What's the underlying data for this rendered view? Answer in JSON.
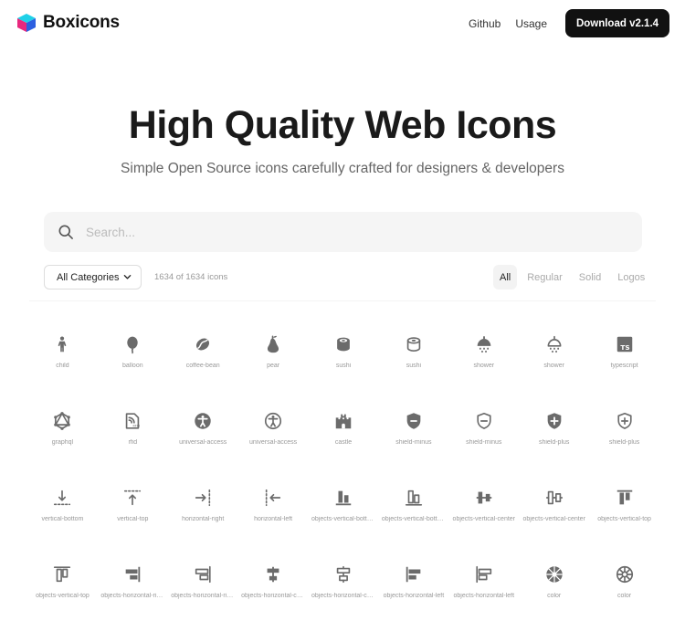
{
  "header": {
    "brand": "Boxicons",
    "nav": [
      "Github",
      "Usage"
    ],
    "download_label": "Download v2.1.4"
  },
  "hero": {
    "title": "High Quality Web Icons",
    "subtitle": "Simple Open Source icons carefully crafted for designers & developers"
  },
  "search": {
    "placeholder": "Search..."
  },
  "filters": {
    "category": "All Categories",
    "count": "1634 of 1634 icons",
    "tabs": [
      "All",
      "Regular",
      "Solid",
      "Logos"
    ],
    "active_tab": "All"
  },
  "colors": {
    "icon": "#6b6b6b",
    "button": "#111111",
    "brand_cyan": "#1fd1e8",
    "brand_pink": "#e8287e",
    "brand_blue": "#2d5fe0"
  },
  "icons": [
    {
      "icon": "child",
      "label": "child"
    },
    {
      "icon": "balloon",
      "label": "balloon"
    },
    {
      "icon": "coffee-bean",
      "label": "coffee-bean"
    },
    {
      "icon": "pear",
      "label": "pear"
    },
    {
      "icon": "sushi-solid",
      "label": "sushi"
    },
    {
      "icon": "sushi-regular",
      "label": "sushi"
    },
    {
      "icon": "shower-solid",
      "label": "shower"
    },
    {
      "icon": "shower-regular",
      "label": "shower"
    },
    {
      "icon": "typescript",
      "label": "typescript"
    },
    {
      "icon": "graphql",
      "label": "graphql"
    },
    {
      "icon": "rfid",
      "label": "rfid"
    },
    {
      "icon": "universal-access-solid",
      "label": "universal-access"
    },
    {
      "icon": "universal-access-regular",
      "label": "universal-access"
    },
    {
      "icon": "castle",
      "label": "castle"
    },
    {
      "icon": "shield-minus-solid",
      "label": "shield-minus"
    },
    {
      "icon": "shield-minus-regular",
      "label": "shield-minus"
    },
    {
      "icon": "shield-plus-solid",
      "label": "shield-plus"
    },
    {
      "icon": "shield-plus-regular",
      "label": "shield-plus"
    },
    {
      "icon": "vertical-bottom",
      "label": "vertical-bottom"
    },
    {
      "icon": "vertical-top",
      "label": "vertical-top"
    },
    {
      "icon": "horizontal-right",
      "label": "horizontal-right"
    },
    {
      "icon": "horizontal-left",
      "label": "horizontal-left"
    },
    {
      "icon": "objects-vertical-bottom-solid",
      "label": "objects-vertical-bottom"
    },
    {
      "icon": "objects-vertical-bottom-regular",
      "label": "objects-vertical-bottom"
    },
    {
      "icon": "objects-vertical-center-solid",
      "label": "objects-vertical-center"
    },
    {
      "icon": "objects-vertical-center-regular",
      "label": "objects-vertical-center"
    },
    {
      "icon": "objects-vertical-top-solid",
      "label": "objects-vertical-top"
    },
    {
      "icon": "objects-vertical-top-regular",
      "label": "objects-vertical-top"
    },
    {
      "icon": "objects-horizontal-right-solid",
      "label": "objects-horizontal-right"
    },
    {
      "icon": "objects-horizontal-right-regular",
      "label": "objects-horizontal-right"
    },
    {
      "icon": "objects-horizontal-center-solid",
      "label": "objects-horizontal-center"
    },
    {
      "icon": "objects-horizontal-center-regular",
      "label": "objects-horizontal-center"
    },
    {
      "icon": "objects-horizontal-left-solid",
      "label": "objects-horizontal-left"
    },
    {
      "icon": "objects-horizontal-left-regular",
      "label": "objects-horizontal-left"
    },
    {
      "icon": "color-solid",
      "label": "color"
    },
    {
      "icon": "color-regular",
      "label": "color"
    }
  ]
}
